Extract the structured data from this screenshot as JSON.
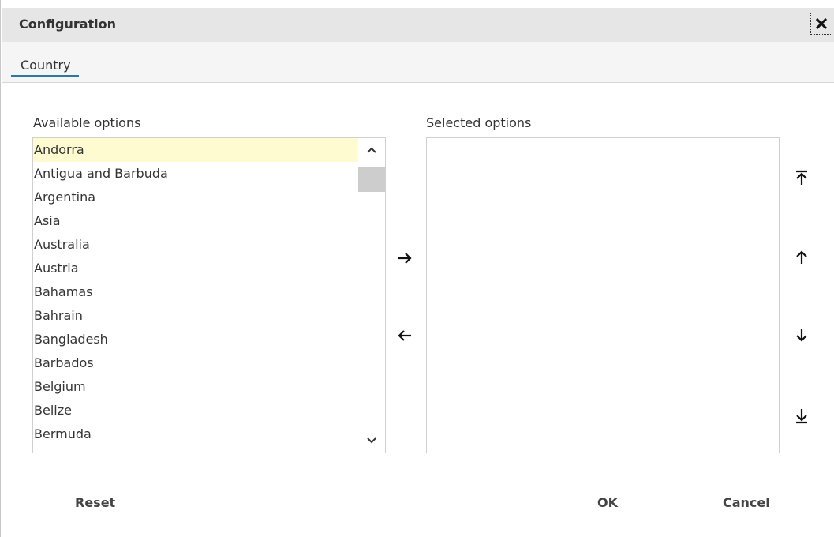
{
  "dialog": {
    "title": "Configuration",
    "close_icon": "close-icon"
  },
  "tabs": [
    {
      "label": "Country",
      "active": true
    }
  ],
  "available": {
    "label": "Available options",
    "items": [
      "Andorra",
      "Antigua and Barbuda",
      "Argentina",
      "Asia",
      "Australia",
      "Austria",
      "Bahamas",
      "Bahrain",
      "Bangladesh",
      "Barbados",
      "Belgium",
      "Belize",
      "Bermuda"
    ],
    "highlighted_item": "Andorra",
    "scroll_up_icon": "chevron-up-icon",
    "scroll_down_icon": "chevron-down-icon"
  },
  "selected": {
    "label": "Selected options",
    "items": []
  },
  "transfer": {
    "add_icon": "arrow-right-icon",
    "remove_icon": "arrow-left-icon"
  },
  "reorder": {
    "move_top_icon": "arrow-to-top-icon",
    "move_up_icon": "arrow-up-icon",
    "move_down_icon": "arrow-down-icon",
    "move_bottom_icon": "arrow-to-bottom-icon"
  },
  "footer": {
    "reset_label": "Reset",
    "ok_label": "OK",
    "cancel_label": "Cancel"
  },
  "colors": {
    "highlight": "#fffbd0",
    "tab_underline": "#2a7a9e",
    "titlebar_bg": "#e6e6e6"
  }
}
